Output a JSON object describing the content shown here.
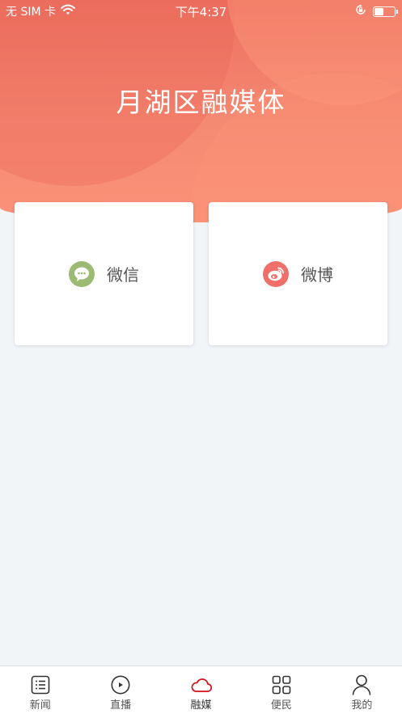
{
  "status_bar": {
    "carrier": "无 SIM 卡",
    "time": "下午4:37",
    "battery_level": 0.45
  },
  "header": {
    "title": "月湖区融媒体"
  },
  "cards": [
    {
      "label": "微信",
      "icon": "wechat-icon",
      "color": "#9cba74"
    },
    {
      "label": "微博",
      "icon": "weibo-icon",
      "color": "#ef6f6b"
    }
  ],
  "tabbar": {
    "active_index": 2,
    "active_color": "#d0121b",
    "items": [
      {
        "label": "新闻",
        "icon": "news-list-icon"
      },
      {
        "label": "直播",
        "icon": "play-circle-icon"
      },
      {
        "label": "融媒",
        "icon": "cloud-icon"
      },
      {
        "label": "便民",
        "icon": "grid-icon"
      },
      {
        "label": "我的",
        "icon": "person-icon"
      }
    ]
  }
}
